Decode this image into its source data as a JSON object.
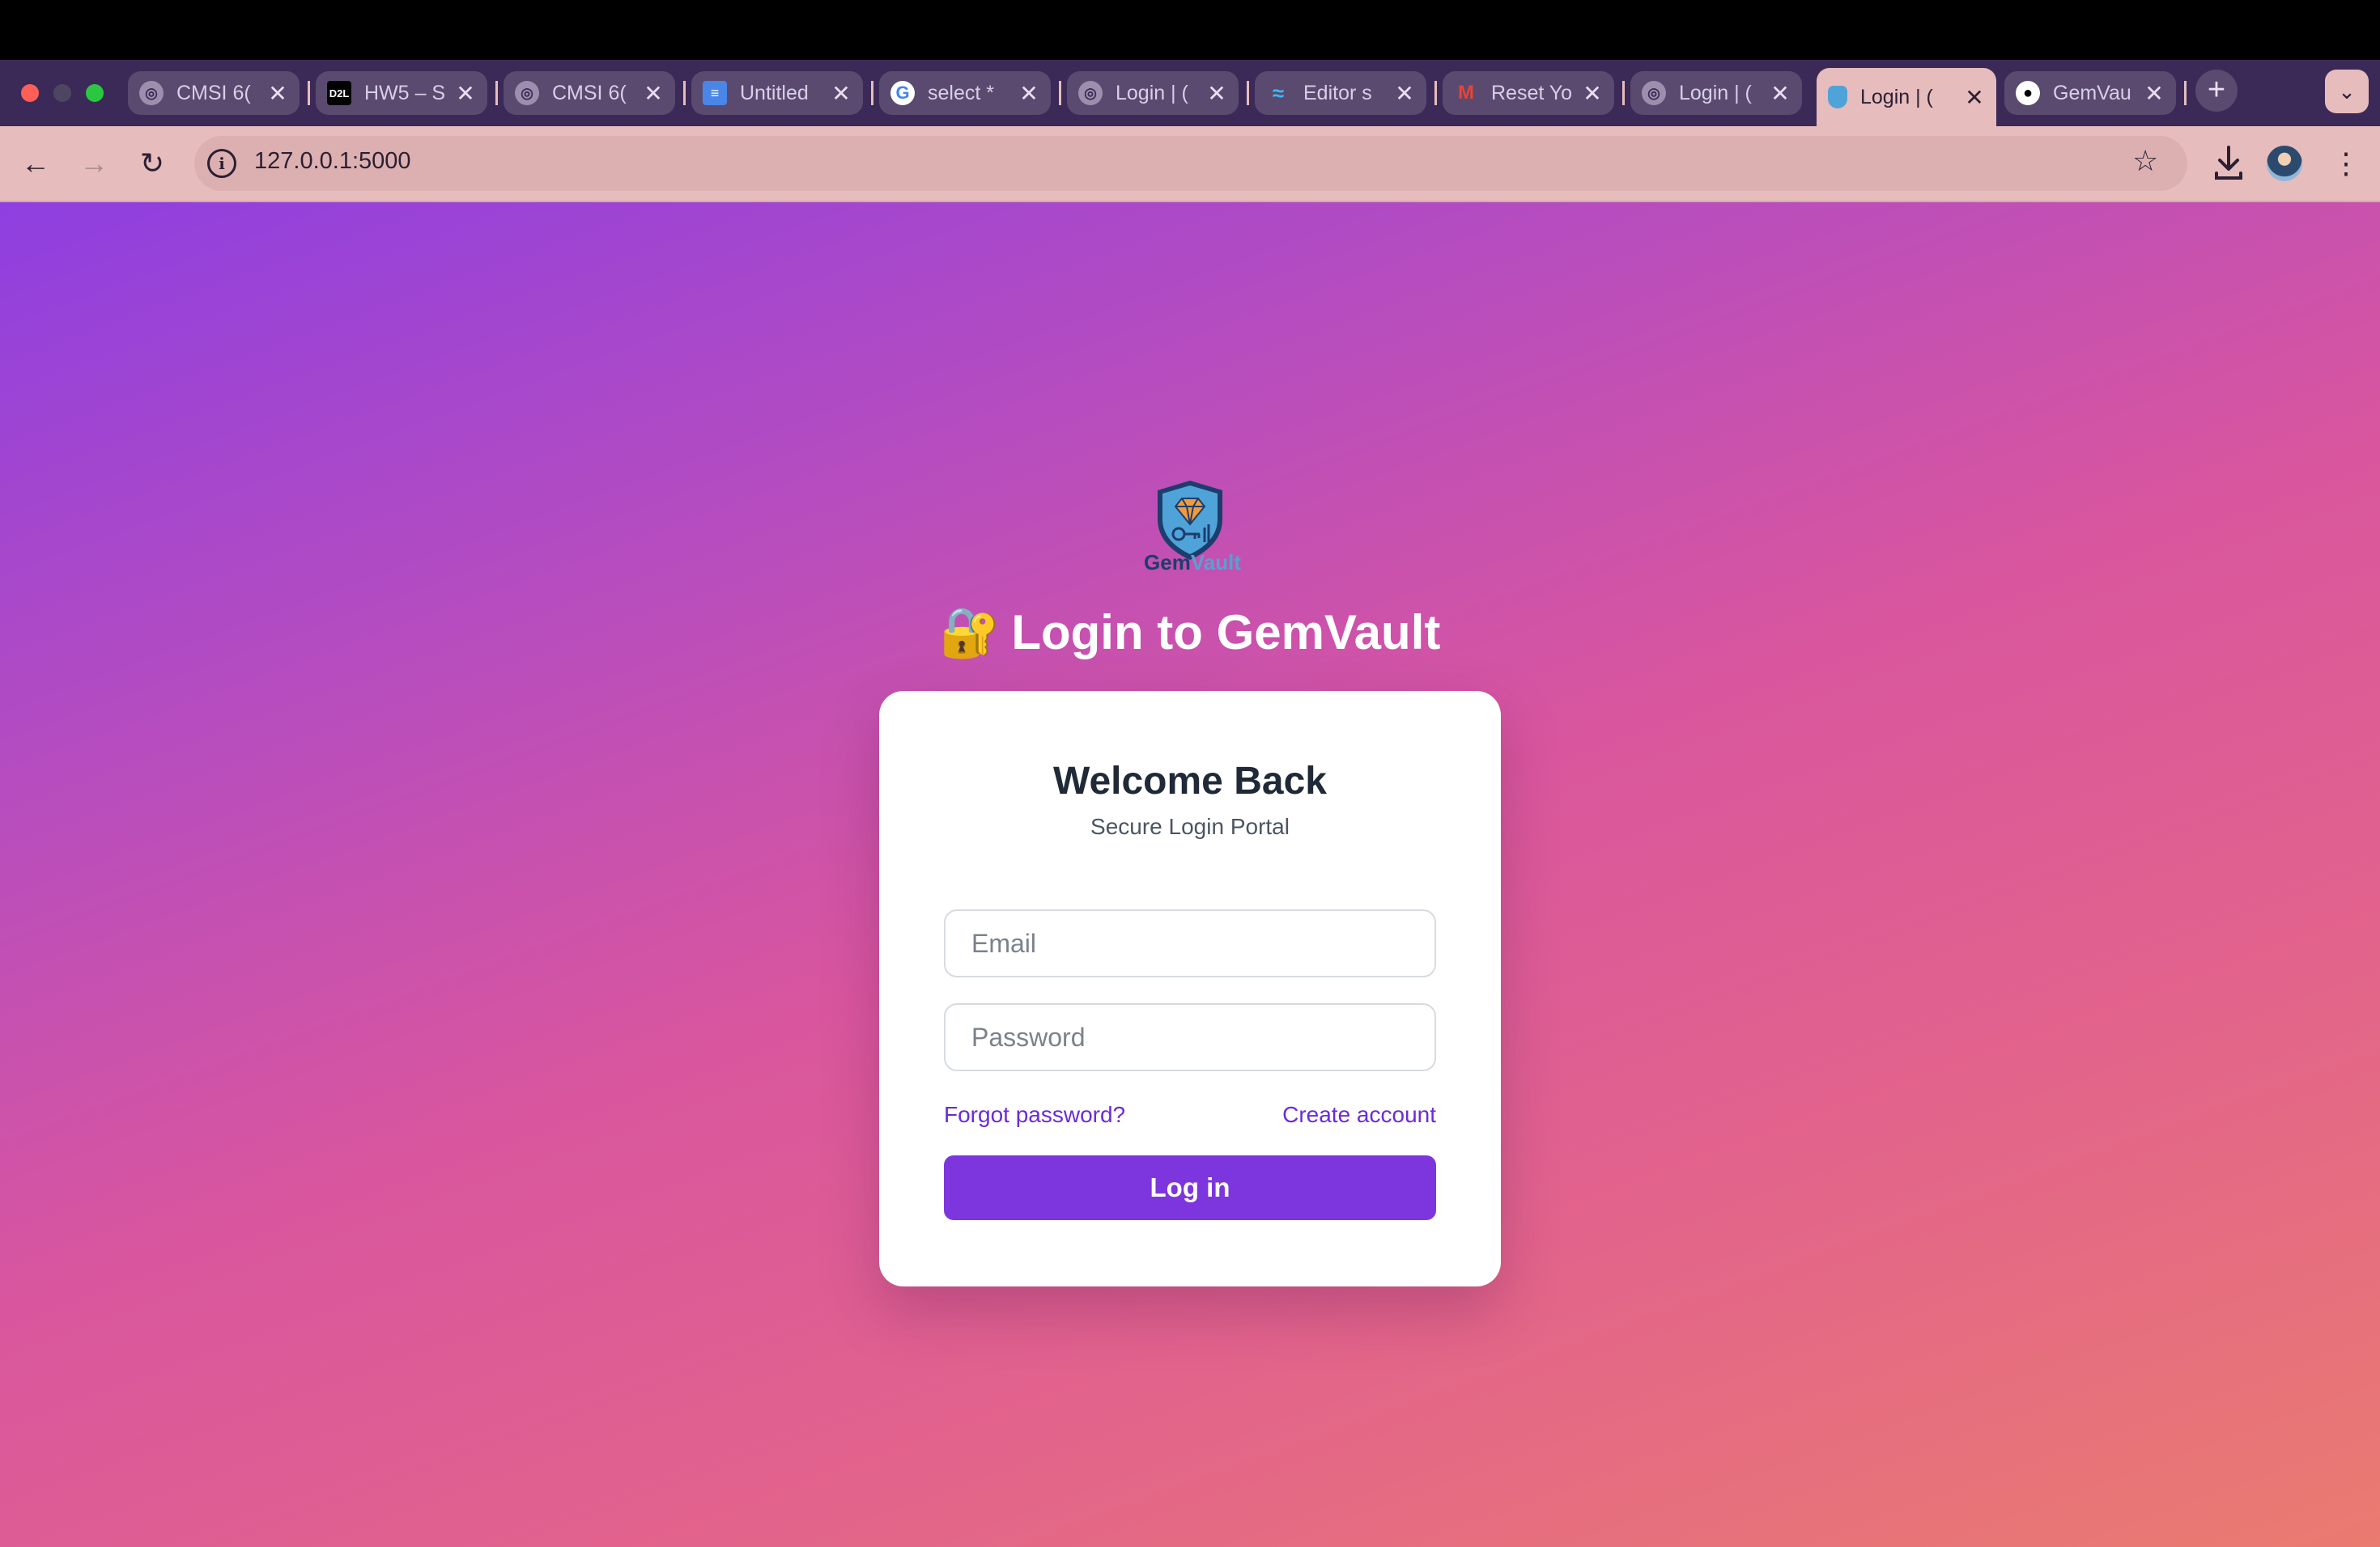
{
  "browser": {
    "tabs": [
      {
        "label": "CMSI 6(",
        "icon": "globe-icon"
      },
      {
        "label": "HW5 – S",
        "icon": "d2l-icon",
        "icon_text": "D2L"
      },
      {
        "label": "CMSI 6(",
        "icon": "globe-icon"
      },
      {
        "label": "Untitled",
        "icon": "docs-icon"
      },
      {
        "label": "select *",
        "icon": "google-icon",
        "icon_text": "G"
      },
      {
        "label": "Login | (",
        "icon": "globe-icon"
      },
      {
        "label": "Editor s",
        "icon": "tailwind-icon"
      },
      {
        "label": "Reset Yo",
        "icon": "gmail-icon",
        "icon_text": "M"
      },
      {
        "label": "Login | (",
        "icon": "globe-icon"
      },
      {
        "label": "Login | (",
        "icon": "gemvault-icon",
        "active": true
      },
      {
        "label": "GemVau",
        "icon": "github-icon"
      }
    ],
    "close_glyph": "✕",
    "new_tab_glyph": "+",
    "tab_menu_glyph": "⌄",
    "url": "127.0.0.1:5000",
    "nav": {
      "back": "←",
      "forward": "→",
      "reload": "↻"
    },
    "site_info_glyph": "i",
    "star_glyph": "☆",
    "menu_glyph": "⋮"
  },
  "page": {
    "logo": {
      "gem": "Gem",
      "vault": "Vault"
    },
    "heading_icon": "🔐",
    "heading": "Login to GemVault",
    "card": {
      "title": "Welcome Back",
      "subtitle": "Secure Login Portal",
      "email_placeholder": "Email",
      "password_placeholder": "Password",
      "forgot_link": "Forgot password?",
      "create_link": "Create account",
      "login_button": "Log in"
    }
  },
  "colors": {
    "accent": "#7d36dd",
    "link": "#6b2bd8",
    "gradient_start": "#8e3fe0",
    "gradient_end": "#ea7b70"
  }
}
